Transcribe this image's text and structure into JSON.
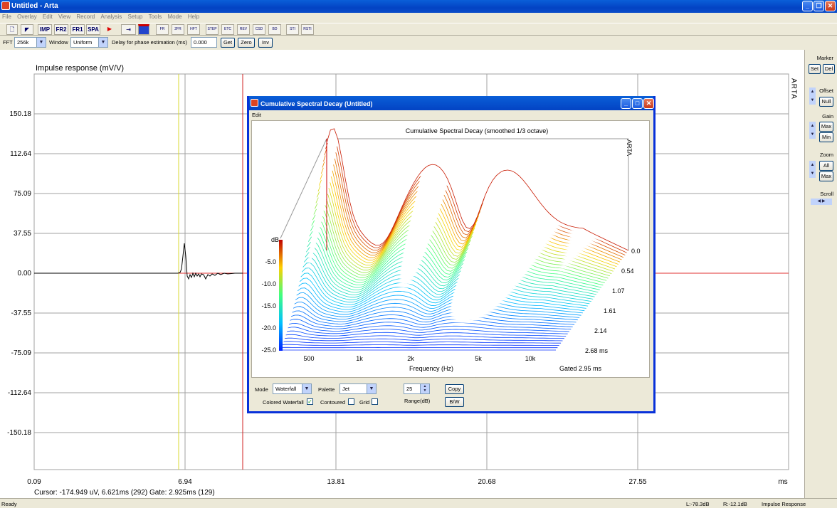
{
  "window": {
    "title": "Untitled - Arta"
  },
  "menu": [
    "File",
    "Overlay",
    "Edit",
    "View",
    "Record",
    "Analysis",
    "Setup",
    "Tools",
    "Mode",
    "Help"
  ],
  "toolbar": {
    "buttons": [
      "IMP",
      "FR2",
      "FR1",
      "SPA"
    ],
    "small_icons": [
      "FR",
      "2FR",
      "HFT",
      "STEP",
      "ETC",
      "REV",
      "CSD",
      "BD",
      "STI",
      "RSTI"
    ]
  },
  "controls": {
    "fft_label": "FFT",
    "fft_value": "256k",
    "window_label": "Window",
    "window_value": "Uniform",
    "delay_label": "Delay for phase estimation (ms)",
    "delay_value": "0.000",
    "get": "Get",
    "zero": "Zero",
    "inv": "Inv"
  },
  "main_plot": {
    "title": "Impulse response (mV/V)",
    "y_ticks": [
      "150.18",
      "112.64",
      "75.09",
      "37.55",
      "0.00",
      "-37.55",
      "-75.09",
      "-112.64",
      "-150.18"
    ],
    "x_ticks": [
      "0.09",
      "6.94",
      "13.81",
      "20.68",
      "27.55"
    ],
    "x_unit": "ms",
    "brand": "ARTA",
    "cursor_text": "Cursor: -174.949 uV, 6.621ms (292)  Gate: 2.925ms (129)",
    "colors": {
      "zero_line": "#e03030",
      "cursor_line": "#d8d830",
      "gate_line": "#d02020",
      "grid": "#a0a0a0"
    }
  },
  "right_panel": {
    "marker": "Marker",
    "set": "Set",
    "del": "Del",
    "offset": "Offset",
    "null": "Null",
    "gain": "Gain",
    "max": "Max",
    "min": "Min",
    "zoom": "Zoom",
    "all": "All",
    "zoom_max": "Max",
    "scroll": "Scroll"
  },
  "status": {
    "left": "Ready",
    "l_level": "L:-78.3dB",
    "r_level": "R:-12.1dB",
    "mode": "Impulse Response"
  },
  "csd_window": {
    "title": "Cumulative Spectral Decay  (Untitled)",
    "menu_edit": "Edit",
    "plot_title": "Cumulative Spectral Decay (smoothed 1/3 octave)",
    "brand": "ARTA",
    "db_label": "dB",
    "db_ticks": [
      "-5.0",
      "-10.0",
      "-15.0",
      "-20.0",
      "-25.0"
    ],
    "freq_ticks": [
      "500",
      "1k",
      "2k",
      "5k",
      "10k"
    ],
    "time_ticks": [
      "0.0",
      "0.54",
      "1.07",
      "1.61",
      "2.14",
      "2.68 ms"
    ],
    "xlabel": "Frequency (Hz)",
    "gated": "Gated 2.95 ms",
    "mode_label": "Mode",
    "mode_value": "Waterfall",
    "palette_label": "Palette",
    "palette_value": "Jet",
    "range_value": "25",
    "range_label": "Range(dB)",
    "copy": "Copy",
    "bw": "B/W",
    "colored_waterfall": "Colored Waterfall",
    "contoured": "Contoured",
    "grid": "Grid"
  }
}
